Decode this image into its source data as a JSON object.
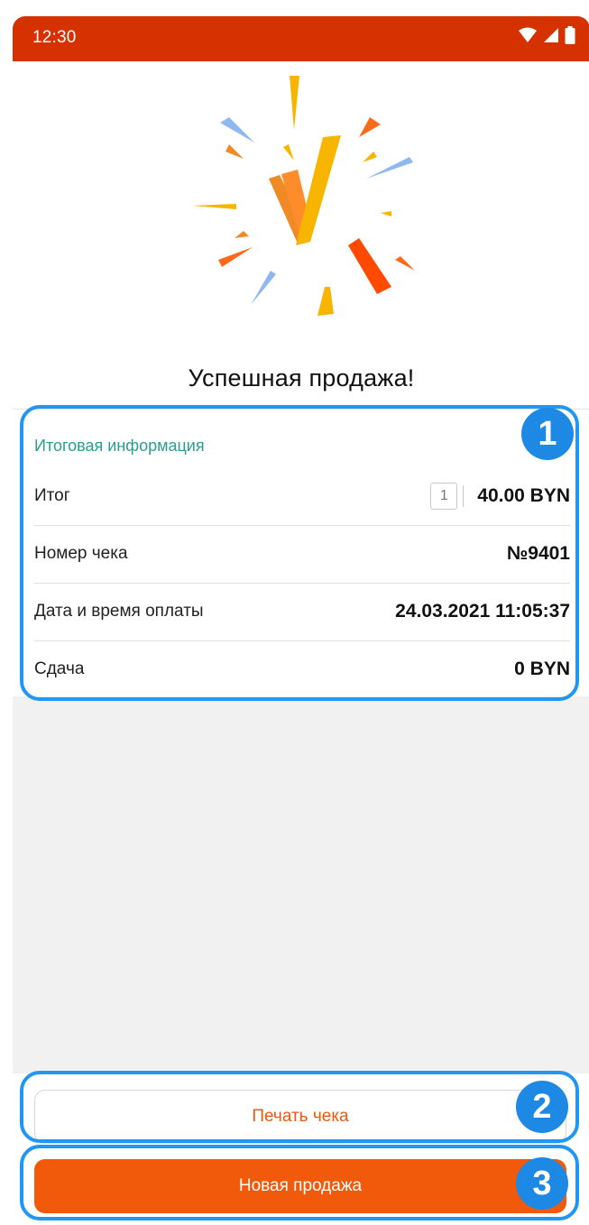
{
  "status_bar": {
    "time": "12:30"
  },
  "hero": {
    "title": "Успешная продажа!"
  },
  "summary": {
    "section_title": "Итоговая информация",
    "rows": [
      {
        "label": "Итог",
        "quantity": "1",
        "value": "40.00 BYN"
      },
      {
        "label": "Номер чека",
        "value": "№9401"
      },
      {
        "label": "Дата и время оплаты",
        "value": "24.03.2021 11:05:37"
      },
      {
        "label": "Сдача",
        "value": "0 BYN"
      }
    ]
  },
  "actions": {
    "print_label": "Печать чека",
    "new_sale_label": "Новая продажа"
  },
  "badges": [
    "1",
    "2",
    "3"
  ],
  "colors": {
    "status_bar": "#d63100",
    "accent_orange": "#f05a0a",
    "section_teal": "#2a9d8f",
    "highlight_blue": "#2196f3"
  }
}
